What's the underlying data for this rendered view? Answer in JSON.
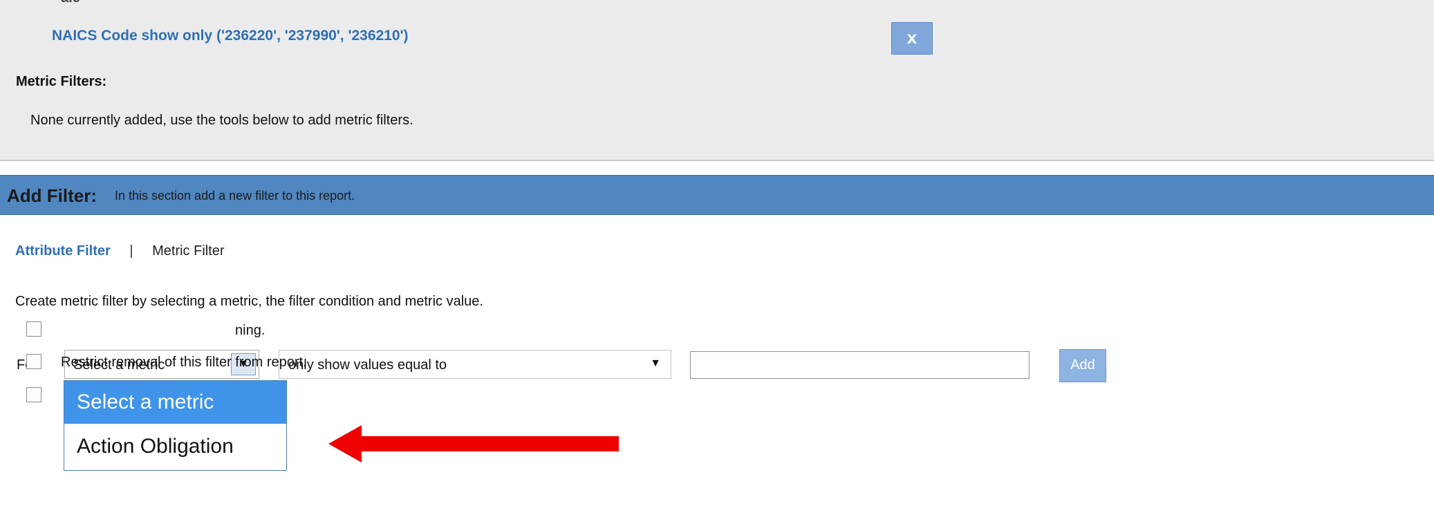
{
  "top": {
    "cut_text": "a.e",
    "naics_filter": "NAICS Code show only ('236220', '237990', '236210')",
    "remove_button": "x",
    "metric_filters_label": "Metric Filters:",
    "metric_filters_none": "None currently added, use the tools below to add metric filters."
  },
  "add_filter": {
    "title": "Add Filter:",
    "description": "In this section add a new filter to this report."
  },
  "tabs": {
    "attribute": "Attribute Filter",
    "separator": "|",
    "metric": "Metric Filter"
  },
  "instructions": "Create metric filter by selecting a metric, the filter condition and metric value.",
  "form": {
    "for_label": "For",
    "metric_select": "Select a metric",
    "condition_select": "only show values equal to",
    "value_input": "",
    "add_button": "Add"
  },
  "dropdown": {
    "options": [
      "Select a metric",
      "Action Obligation"
    ],
    "selected_index": 0
  },
  "checkboxes": [
    {
      "label_visible": "ning.",
      "checked": false
    },
    {
      "label": "Restrict removal of this filter from report.",
      "checked": false
    },
    {
      "label_cut": "",
      "checked": false
    }
  ],
  "colors": {
    "header_bar": "#5187c0",
    "link": "#2f6fb4",
    "dropdown_highlight": "#3f94ea",
    "annotation_arrow": "#ee0000"
  }
}
